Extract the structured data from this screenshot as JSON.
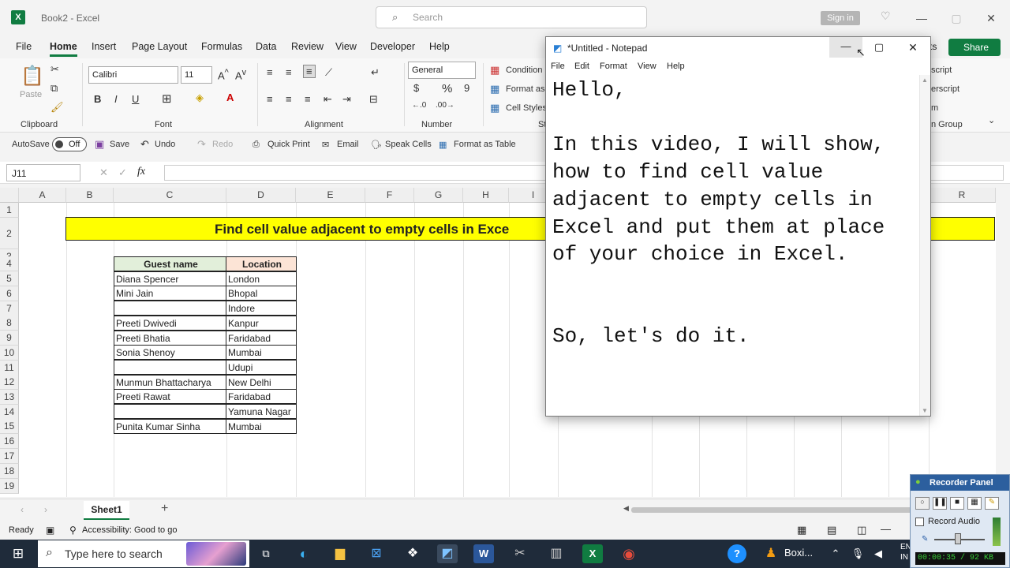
{
  "excel": {
    "logo": "X",
    "title": "Book2  -  Excel",
    "search_placeholder": "Search",
    "signin_label": "Sign in",
    "menu": [
      "File",
      "Home",
      "Insert",
      "Page Layout",
      "Formulas",
      "Data",
      "Review",
      "View",
      "Developer",
      "Help"
    ],
    "share_label": "Share",
    "ribbon": {
      "clipboard": {
        "label": "Clipboard",
        "paste": "Paste"
      },
      "font": {
        "label": "Font",
        "name": "Calibri",
        "size": "11"
      },
      "alignment": {
        "label": "Alignment"
      },
      "number": {
        "label": "Number",
        "format": "General"
      },
      "styles": {
        "conditional": "Condition",
        "format_as": "Format as",
        "cell_styles": "Cell Styles",
        "label_partial": "St"
      },
      "right": {
        "line1": "script",
        "line2": "erscript",
        "line3": "m",
        "group": "n Group",
        "ts": "ts"
      }
    },
    "qat": {
      "autosave": "AutoSave",
      "toggle": "Off",
      "items": [
        "Save",
        "Undo",
        "Redo",
        "Quick Print",
        "Email",
        "Speak Cells",
        "Format as Table"
      ]
    },
    "namebox": "J11",
    "fx": "fx",
    "columns": [
      "A",
      "B",
      "C",
      "D",
      "E",
      "F",
      "G",
      "H",
      "I",
      "R"
    ],
    "rows": [
      "1",
      "2",
      "3",
      "4",
      "5",
      "6",
      "7",
      "8",
      "9",
      "10",
      "11",
      "12",
      "13",
      "14",
      "15",
      "16",
      "17",
      "18",
      "19"
    ],
    "banner_text": "Find cell value adjacent to empty cells in Exce",
    "table": {
      "headers": [
        "Guest name",
        "Location"
      ],
      "rows": [
        [
          "Diana Spencer",
          "London"
        ],
        [
          "Mini Jain",
          "Bhopal"
        ],
        [
          "",
          "Indore"
        ],
        [
          "Preeti Dwivedi",
          "Kanpur"
        ],
        [
          "Preeti Bhatia",
          "Faridabad"
        ],
        [
          "Sonia Shenoy",
          "Mumbai"
        ],
        [
          "",
          "Udupi"
        ],
        [
          "Munmun Bhattacharya",
          "New Delhi"
        ],
        [
          "Preeti Rawat",
          "Faridabad"
        ],
        [
          "",
          "Yamuna Nagar"
        ],
        [
          "Punita Kumar Sinha",
          "Mumbai"
        ]
      ]
    },
    "sheet_tab": "Sheet1",
    "status": {
      "ready": "Ready",
      "accessibility": "Accessibility: Good to go"
    }
  },
  "notepad": {
    "title": "*Untitled - Notepad",
    "menu": [
      "File",
      "Edit",
      "Format",
      "View",
      "Help"
    ],
    "text": "Hello,\n\nIn this video, I will show,\nhow to find cell value\nadjacent to empty cells in\nExcel and put them at place\nof your choice in Excel.\n\n\nSo, let's do it."
  },
  "taskbar": {
    "search_placeholder": "Type here to search",
    "app_label": "Boxi...",
    "lang": "EN\nIN"
  },
  "recorder": {
    "title": "Recorder Panel",
    "record_audio": "Record Audio",
    "timer": "00:00:35 / 92 KB"
  },
  "colors": {
    "excel_green": "#107c41",
    "banner_yellow": "#ffff00",
    "guest_header": "#e2efda",
    "location_header": "#fce4d6"
  }
}
